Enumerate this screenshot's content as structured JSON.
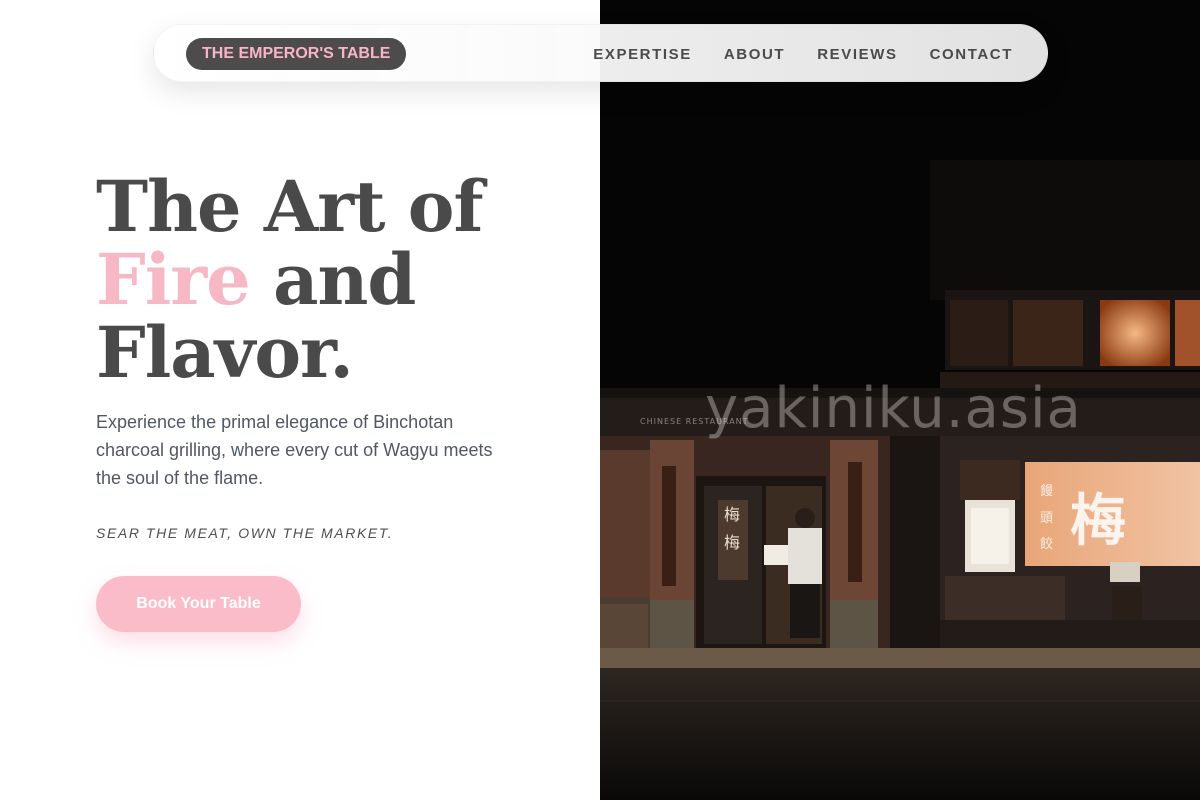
{
  "brand": {
    "label": "THE EMPEROR'S TABLE"
  },
  "nav": {
    "links": [
      {
        "label": "EXPERTISE"
      },
      {
        "label": "ABOUT"
      },
      {
        "label": "REVIEWS"
      },
      {
        "label": "CONTACT"
      }
    ]
  },
  "hero": {
    "title_line1": "The Art of",
    "title_accent": "Fire",
    "title_line2_rest": " and",
    "title_line3": "Flavor.",
    "subtitle": "Experience the primal elegance of Binchotan charcoal grilling, where every cut of Wagyu meets the soul of the flame.",
    "tagline": "SEAR THE MEAT, OWN THE MARKET.",
    "cta_label": "Book Your Table"
  },
  "photo": {
    "watermark": "yakiniku.asia",
    "shop_sign_text": "CHINESE RESTAURANT",
    "noren_glyph": "梅",
    "door_glyphs": "梅梅",
    "side_glyphs": "饅頭餃子"
  },
  "colors": {
    "accent_pink": "#f7b8c6",
    "brand_bg": "#4d4b4c",
    "text_dark": "#4a4a4a",
    "cta_bg": "#fbbcca"
  }
}
